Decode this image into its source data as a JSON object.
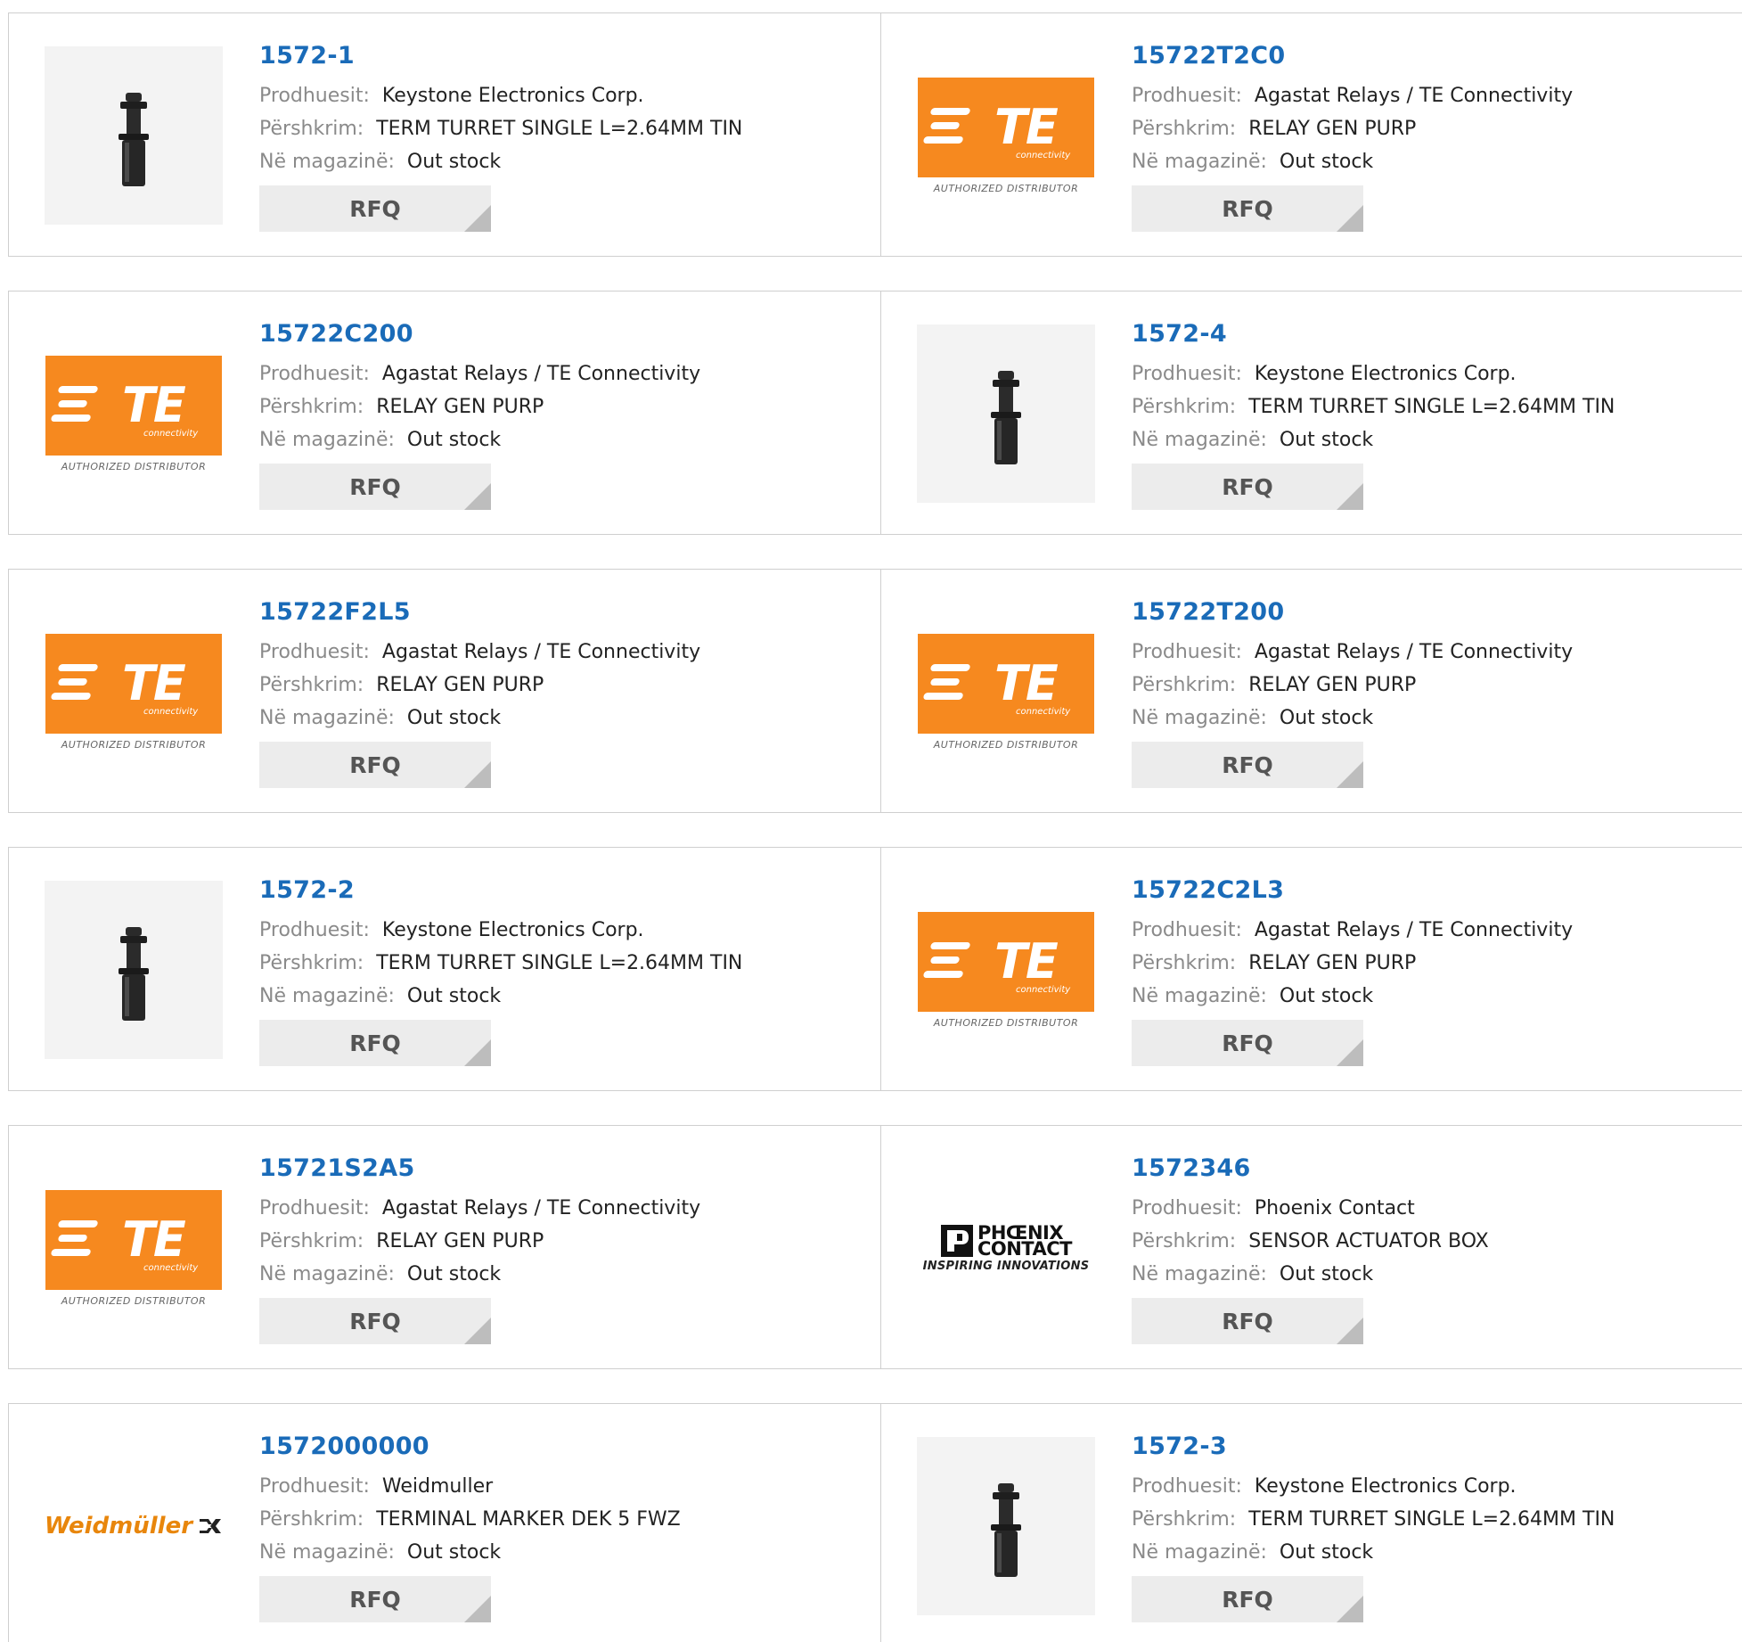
{
  "labels": {
    "manufacturer": "Prodhuesit:",
    "description": "Përshkrim:",
    "stock": "Në magazinë:",
    "rfq": "RFQ"
  },
  "logos": {
    "te_name": "TE",
    "te_sub": "connectivity",
    "te_caption": "AUTHORIZED DISTRIBUTOR",
    "phoenix_line1": "PHŒNIX",
    "phoenix_line2": "CONTACT",
    "phoenix_caption": "INSPIRING INNOVATIONS",
    "weidmuller_name": "Weidmüller"
  },
  "colors": {
    "link": "#1a6bb8",
    "te_orange": "#f6891f",
    "weidmuller": "#e8860c"
  },
  "products": [
    {
      "pn": "1572-1",
      "logo": "part",
      "manufacturer": "Keystone Electronics Corp.",
      "description": "TERM TURRET SINGLE L=2.64MM TIN",
      "stock": "Out stock"
    },
    {
      "pn": "15722T2C0",
      "logo": "te",
      "manufacturer": "Agastat Relays / TE Connectivity",
      "description": "RELAY GEN PURP",
      "stock": "Out stock"
    },
    {
      "pn": "15722C200",
      "logo": "te",
      "manufacturer": "Agastat Relays / TE Connectivity",
      "description": "RELAY GEN PURP",
      "stock": "Out stock"
    },
    {
      "pn": "1572-4",
      "logo": "part",
      "manufacturer": "Keystone Electronics Corp.",
      "description": "TERM TURRET SINGLE L=2.64MM TIN",
      "stock": "Out stock"
    },
    {
      "pn": "15722F2L5",
      "logo": "te",
      "manufacturer": "Agastat Relays / TE Connectivity",
      "description": "RELAY GEN PURP",
      "stock": "Out stock"
    },
    {
      "pn": "15722T200",
      "logo": "te",
      "manufacturer": "Agastat Relays / TE Connectivity",
      "description": "RELAY GEN PURP",
      "stock": "Out stock"
    },
    {
      "pn": "1572-2",
      "logo": "part",
      "manufacturer": "Keystone Electronics Corp.",
      "description": "TERM TURRET SINGLE L=2.64MM TIN",
      "stock": "Out stock"
    },
    {
      "pn": "15722C2L3",
      "logo": "te",
      "manufacturer": "Agastat Relays / TE Connectivity",
      "description": "RELAY GEN PURP",
      "stock": "Out stock"
    },
    {
      "pn": "15721S2A5",
      "logo": "te",
      "manufacturer": "Agastat Relays / TE Connectivity",
      "description": "RELAY GEN PURP",
      "stock": "Out stock"
    },
    {
      "pn": "1572346",
      "logo": "phoenix",
      "manufacturer": "Phoenix Contact",
      "description": "SENSOR ACTUATOR BOX",
      "stock": "Out stock"
    },
    {
      "pn": "1572000000",
      "logo": "weidmuller",
      "manufacturer": "Weidmuller",
      "description": "TERMINAL MARKER DEK 5 FWZ",
      "stock": "Out stock"
    },
    {
      "pn": "1572-3",
      "logo": "part",
      "manufacturer": "Keystone Electronics Corp.",
      "description": "TERM TURRET SINGLE L=2.64MM TIN",
      "stock": "Out stock"
    }
  ]
}
